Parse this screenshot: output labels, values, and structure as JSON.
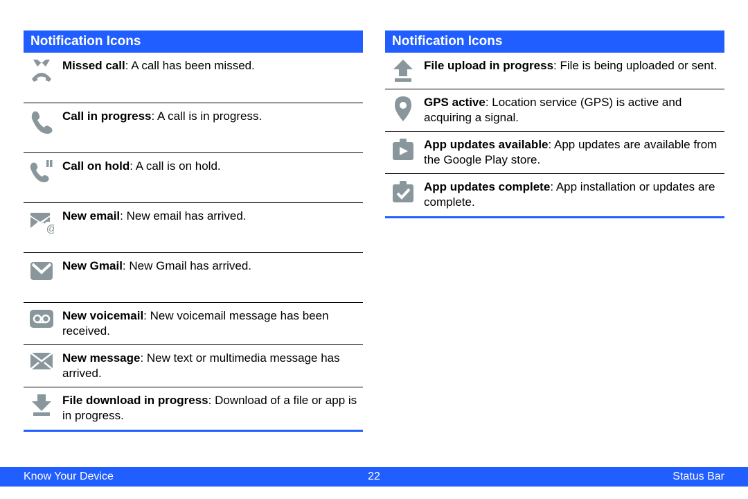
{
  "left": {
    "header": "Notification Icons",
    "items": [
      {
        "icon": "missed-call-icon",
        "title": "Missed call",
        "desc": ": A call has been missed."
      },
      {
        "icon": "call-progress-icon",
        "title": "Call in progress",
        "desc": ": A call is in progress."
      },
      {
        "icon": "call-hold-icon",
        "title": "Call on hold",
        "desc": ": A call is on hold."
      },
      {
        "icon": "new-email-icon",
        "title": "New email",
        "desc": ": New email has arrived."
      },
      {
        "icon": "gmail-icon",
        "title": "New Gmail",
        "desc": ": New Gmail has arrived."
      },
      {
        "icon": "voicemail-icon",
        "title": "New voicemail",
        "desc": ": New voicemail message has been received."
      },
      {
        "icon": "message-icon",
        "title": "New message",
        "desc": ": New text or multimedia message has arrived."
      },
      {
        "icon": "download-icon",
        "title": "File download in progress",
        "desc": ": Download of a file or app is in progress."
      }
    ]
  },
  "right": {
    "header": "Notification Icons",
    "items": [
      {
        "icon": "upload-icon",
        "title": "File upload in progress",
        "desc": ": File is being uploaded or sent."
      },
      {
        "icon": "gps-icon",
        "title": "GPS active",
        "desc": ": Location service (GPS) is active and acquiring a signal."
      },
      {
        "icon": "play-store-icon",
        "title": "App updates available",
        "desc": ": App updates are available from the Google Play store."
      },
      {
        "icon": "updates-complete-icon",
        "title": "App updates complete",
        "desc": ": App installation or updates are complete."
      }
    ]
  },
  "footer": {
    "left": "Know Your Device",
    "center": "22",
    "right": "Status Bar"
  }
}
